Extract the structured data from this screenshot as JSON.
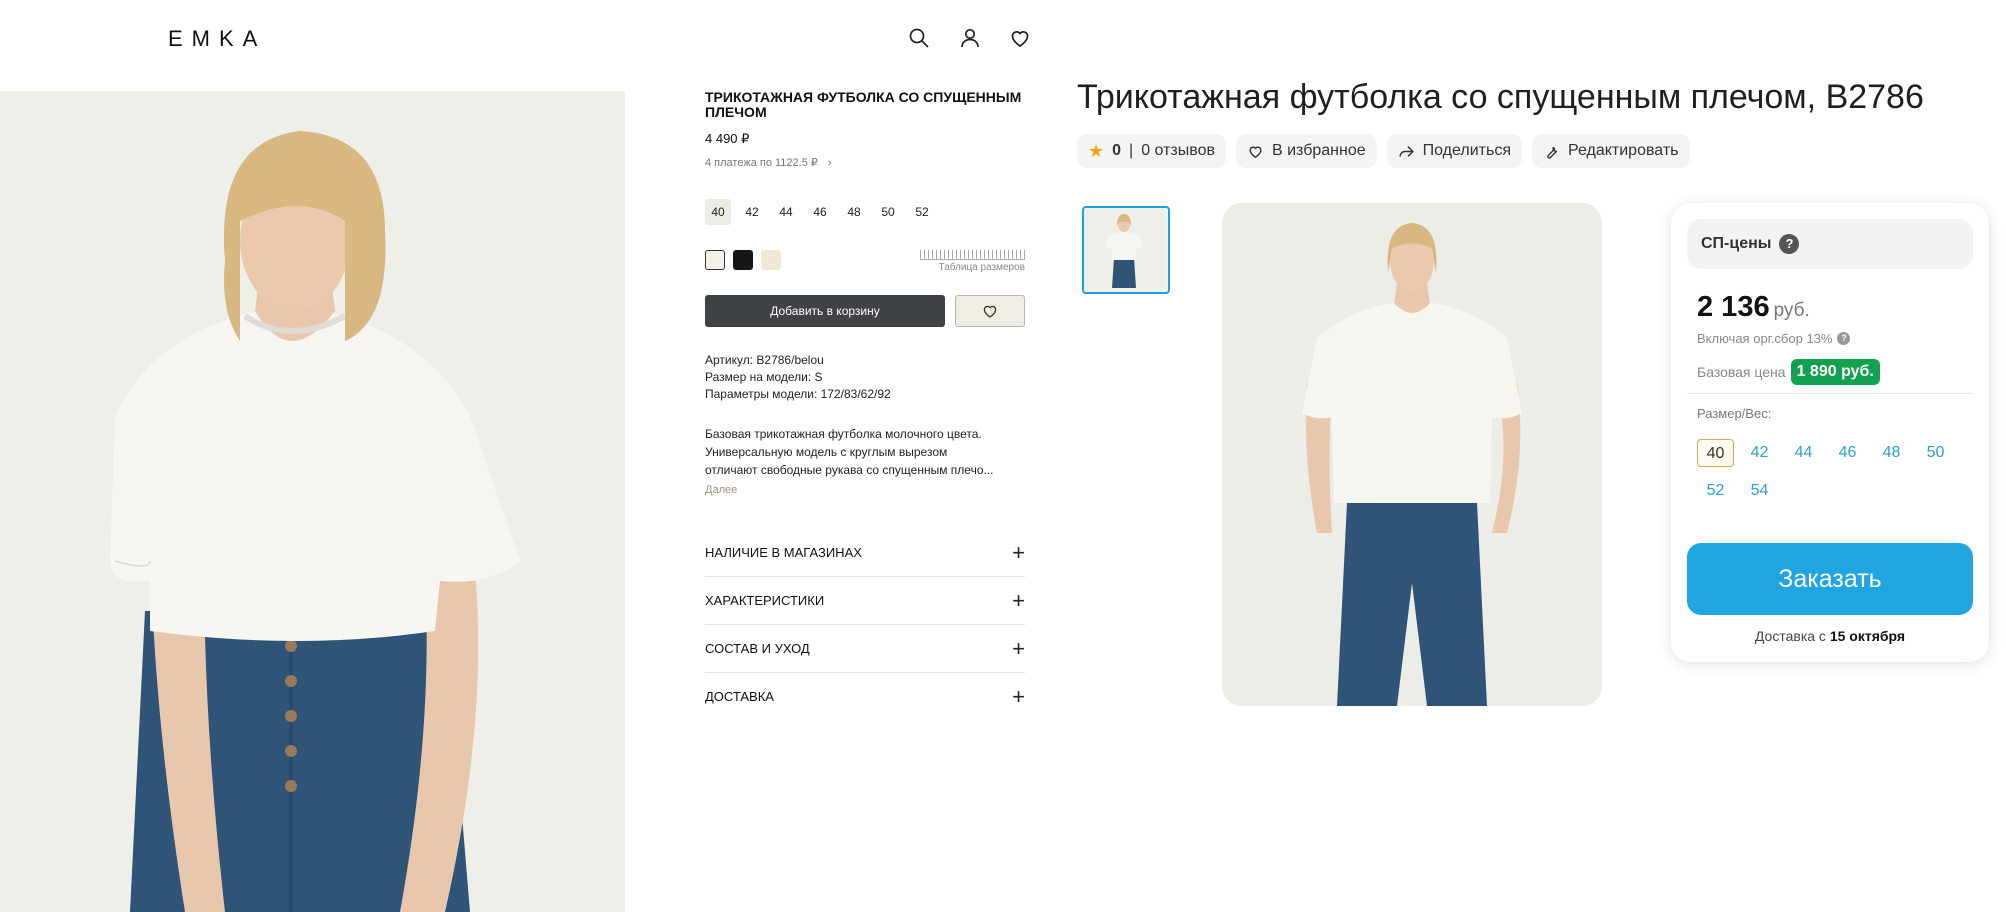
{
  "header": {
    "logo": "EMKA",
    "icons": [
      "search-icon",
      "user-icon",
      "heart-icon"
    ]
  },
  "product": {
    "title": "ТРИКОТАЖНАЯ ФУТБОЛКА СО СПУЩЕННЫМ ПЛЕЧОМ",
    "price": "4 490 ₽",
    "installment": "4 платежа по 1122.5 ₽",
    "sizes": [
      "40",
      "42",
      "44",
      "46",
      "48",
      "50",
      "52"
    ],
    "selected_size": "40",
    "colors": [
      "#f4f1ea",
      "#161616",
      "#efe8d6"
    ],
    "size_chart_label": "Таблица размеров",
    "add_to_cart": "Добавить в корзину",
    "specs": {
      "article": "Артикул: B2786/belou",
      "model_size": "Размер на модели: S",
      "model_params": "Параметры модели: 172/83/62/92"
    },
    "description": {
      "line1": "Базовая трикотажная футболка молочного цвета.",
      "line2": "Универсальную модель с круглым вырезом",
      "line3": "отличают свободные рукава со спущенным плечо...",
      "more": "Далее"
    },
    "accordion": [
      "НАЛИЧИЕ В МАГАЗИНАХ",
      "ХАРАКТЕРИСТИКИ",
      "СОСТАВ И УХОД",
      "ДОСТАВКА"
    ]
  },
  "overlay": {
    "title": "Трикотажная футболка со спущенным плечом, B2786",
    "rating": "0",
    "reviews": "0 отзывов",
    "favorites": "В избранное",
    "share": "Поделиться",
    "edit": "Редактировать",
    "sp_label": "СП-цены",
    "help_mark": "?",
    "price_value": "2 136",
    "price_currency": "руб.",
    "includes": "Включая орг.сбор 13%",
    "base_label": "Базовая цена",
    "base_value": "1 890 руб.",
    "size_weight_label": "Размер/Вес:",
    "sizes": [
      "40",
      "42",
      "44",
      "46",
      "48",
      "50",
      "52",
      "54"
    ],
    "selected_size": "40",
    "order": "Заказать",
    "delivery_prefix": "Доставка с",
    "delivery_date": "15 октября",
    "colors": {
      "accent": "#1fa6e1",
      "badge": "#13a050",
      "rating_star": "#f2a31b"
    }
  }
}
